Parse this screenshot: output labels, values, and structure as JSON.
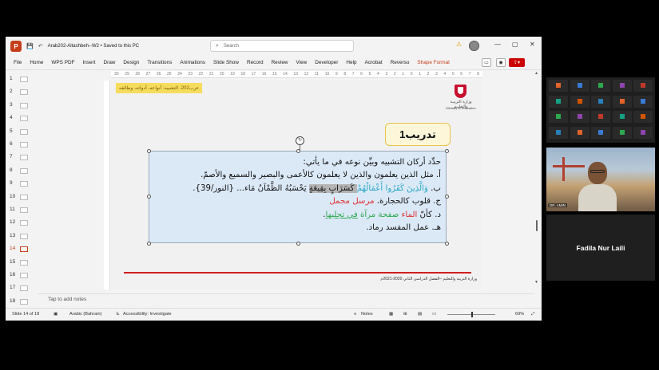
{
  "window": {
    "title": "Arab202-Altashbeh--W2 • Saved to this PC",
    "search_placeholder": "Search",
    "win_controls": [
      "—",
      "▢",
      "✕"
    ]
  },
  "ribbon": {
    "tabs": [
      "File",
      "Home",
      "WPS PDF",
      "Insert",
      "Draw",
      "Design",
      "Transitions",
      "Animations",
      "Slide Show",
      "Record",
      "Review",
      "View",
      "Developer",
      "Help",
      "Acrobat",
      "Reverso",
      "Shape Format"
    ]
  },
  "thumbnails": {
    "numbers": [
      "1",
      "2",
      "3",
      "4",
      "5",
      "6",
      "7",
      "8",
      "9",
      "10",
      "11",
      "12",
      "13",
      "14",
      "15",
      "16",
      "17",
      "18"
    ],
    "active": "14"
  },
  "ruler": {
    "ticks": [
      "30",
      "29",
      "28",
      "27",
      "26",
      "25",
      "24",
      "23",
      "22",
      "21",
      "20",
      "19",
      "18",
      "17",
      "16",
      "15",
      "14",
      "13",
      "12",
      "11",
      "10",
      "9",
      "8",
      "7",
      "6",
      "5",
      "4",
      "3",
      "2",
      "1",
      "0",
      "1",
      "2",
      "3",
      "4",
      "5",
      "6",
      "7",
      "8"
    ]
  },
  "slide": {
    "topic_label": "عرب202- التشبيه: أنواعه، أدواته، وظائفه",
    "logo_ar": "وزارة التربيـة والتعليـم",
    "logo_en": "Ministry of Education",
    "drill_title": "تدريب1",
    "lines": {
      "l1": "حدِّد أركان التشبيه وبيِّن نوعه في ما يأتي:",
      "l2": "أ. مثل الذين يعلمون والذين لا يعلمون كالأعمى والبصير والسميع والأصمّ.",
      "l3_a": "ب. ",
      "l3_b": "وَالَّذِينَ كَفَرُوا أَعْمَالُهُمْ",
      "l3_c": " كَسَرَابٍ بِقِيعَةٍ",
      "l3_d": " يَحْسَبُهُ الظَّمْآنُ مَاء... {النور/39}.",
      "l4_a": "ج. قلوب كالحجارة.  ",
      "l4_b": "مرسل مجمل",
      "l5_a": "د. كأنّ ",
      "l5_b": "الماء",
      "l5_c": " صفحة مرآة ",
      "l5_d": "في تجليها",
      "l5_e": ".",
      "l6": "هـ. عمل المفسد رماد."
    },
    "footer": "وزارة التربية والتعليم –الفصل الدراسي الثاني 2020-2021م"
  },
  "notes_placeholder": "Tap to add notes",
  "status": {
    "slide": "Slide 14 of 18",
    "language": "Arabic (Bahrain)",
    "accessibility": "Accessibility: Investigate",
    "notes": "Notes",
    "zoom": "69%"
  },
  "meeting": {
    "speaker_name": "DR. AMIN",
    "tile_name": "Fadila Nur Laili"
  }
}
